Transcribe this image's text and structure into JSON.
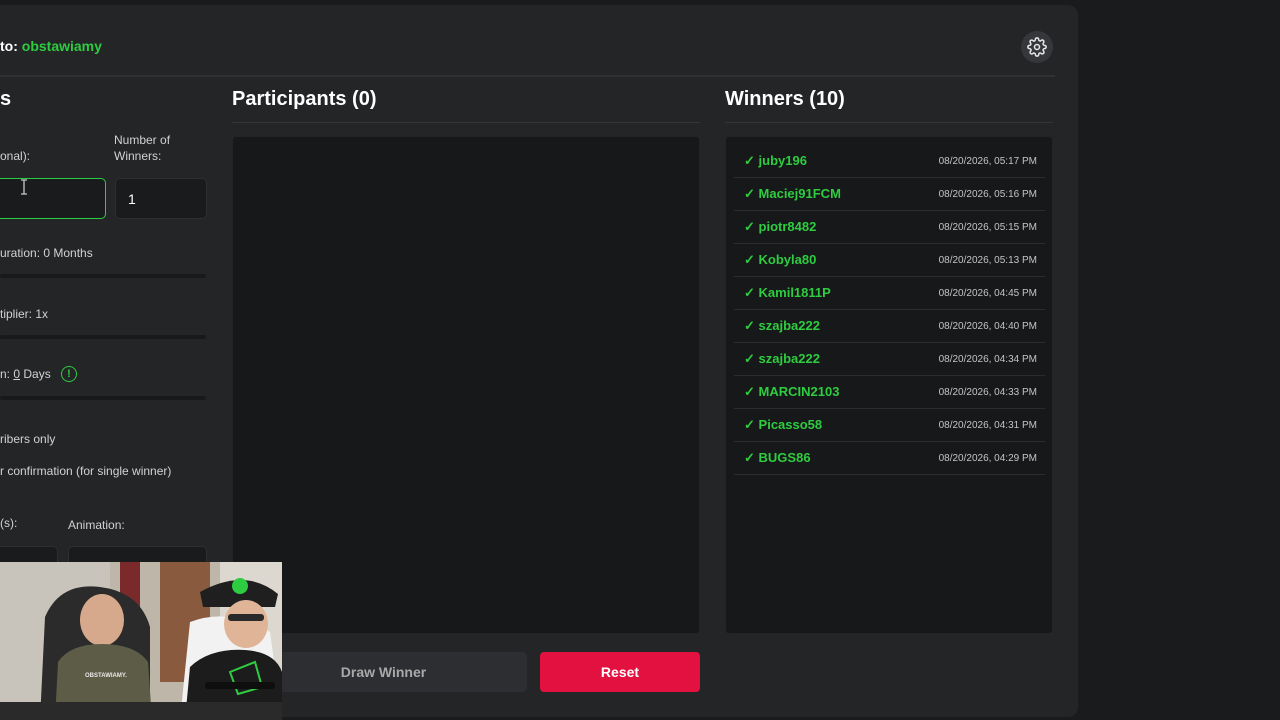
{
  "header": {
    "channel_prefix": "to: ",
    "channel_name": "obstawiamy",
    "settings_icon": "gear-icon"
  },
  "settings": {
    "title": "s",
    "keyword_label": "onal):",
    "keyword_value": "",
    "winners_label_line1": "Number of",
    "winners_label_line2": "Winners:",
    "winners_value": "1",
    "duration_label": "uration: 0 Months",
    "multiplier_label": "tiplier: 1x",
    "min_prefix": "n:",
    "min_value": "0",
    "min_unit": "Days",
    "subscribers_label": "ribers only",
    "confirmation_label": "r confirmation (for single winner)",
    "time_label": "(s):",
    "animation_label": "Animation:"
  },
  "participants": {
    "title": "Participants (0)"
  },
  "winners": {
    "title": "Winners (10)",
    "check": "✓",
    "items": [
      {
        "name": "juby196",
        "time": "08/20/2026, 05:17 PM"
      },
      {
        "name": "Maciej91FCM",
        "time": "08/20/2026, 05:16 PM"
      },
      {
        "name": "piotr8482",
        "time": "08/20/2026, 05:15 PM"
      },
      {
        "name": "Kobyla80",
        "time": "08/20/2026, 05:13 PM"
      },
      {
        "name": "Kamil1811P",
        "time": "08/20/2026, 04:45 PM"
      },
      {
        "name": "szajba222",
        "time": "08/20/2026, 04:40 PM"
      },
      {
        "name": "szajba222",
        "time": "08/20/2026, 04:34 PM"
      },
      {
        "name": "MARCIN2103",
        "time": "08/20/2026, 04:33 PM"
      },
      {
        "name": "Picasso58",
        "time": "08/20/2026, 04:31 PM"
      },
      {
        "name": "BUGS86",
        "time": "08/20/2026, 04:29 PM"
      }
    ]
  },
  "actions": {
    "draw_label": "Draw Winner",
    "reset_label": "Reset"
  },
  "webcam": {
    "shirt_text": "OBSTAWIAMY."
  }
}
